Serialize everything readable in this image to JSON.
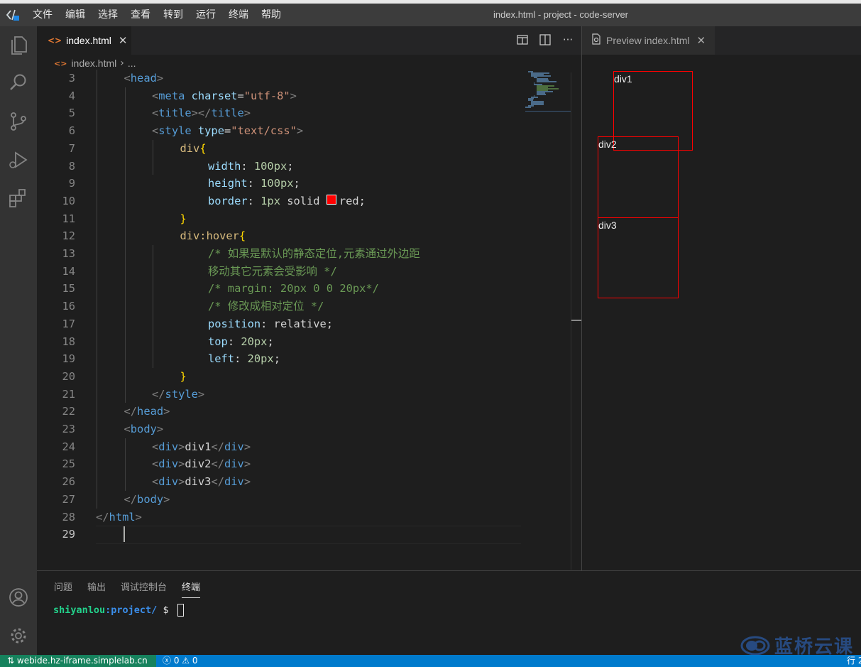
{
  "window": {
    "title": "index.html - project - code-server",
    "menu": [
      "文件",
      "编辑",
      "选择",
      "查看",
      "转到",
      "运行",
      "终端",
      "帮助"
    ]
  },
  "activity_bar": {
    "top_icons": [
      "files-icon",
      "search-icon",
      "source-control-icon",
      "run-debug-icon",
      "extensions-icon"
    ],
    "bottom_icons": [
      "account-icon",
      "settings-gear-icon"
    ]
  },
  "editor": {
    "tab_label": "index.html",
    "breadcrumb": {
      "file": "index.html",
      "trail": "..."
    },
    "current_line": "29",
    "lines": [
      {
        "n": "3",
        "indent": 1,
        "tokens": [
          [
            "t-punc",
            "<"
          ],
          [
            "t-tag",
            "head"
          ],
          [
            "t-punc",
            ">"
          ]
        ]
      },
      {
        "n": "4",
        "indent": 2,
        "tokens": [
          [
            "t-punc",
            "<"
          ],
          [
            "t-tag",
            "meta "
          ],
          [
            "t-attr",
            "charset"
          ],
          [
            "t-txt",
            "="
          ],
          [
            "t-str",
            "\"utf-8\""
          ],
          [
            "t-punc",
            ">"
          ]
        ]
      },
      {
        "n": "5",
        "indent": 2,
        "tokens": [
          [
            "t-punc",
            "<"
          ],
          [
            "t-tag",
            "title"
          ],
          [
            "t-punc",
            "></"
          ],
          [
            "t-tag",
            "title"
          ],
          [
            "t-punc",
            ">"
          ]
        ]
      },
      {
        "n": "6",
        "indent": 2,
        "tokens": [
          [
            "t-punc",
            "<"
          ],
          [
            "t-tag",
            "style "
          ],
          [
            "t-attr",
            "type"
          ],
          [
            "t-txt",
            "="
          ],
          [
            "t-str",
            "\"text/css\""
          ],
          [
            "t-punc",
            ">"
          ]
        ]
      },
      {
        "n": "7",
        "indent": 3,
        "tokens": [
          [
            "t-sel",
            "div"
          ],
          [
            "t-brace",
            "{"
          ]
        ]
      },
      {
        "n": "8",
        "indent": 4,
        "tokens": [
          [
            "t-prop",
            "width"
          ],
          [
            "t-txt",
            ": "
          ],
          [
            "t-num",
            "100px"
          ],
          [
            "t-txt",
            ";"
          ]
        ]
      },
      {
        "n": "9",
        "indent": 4,
        "tokens": [
          [
            "t-prop",
            "height"
          ],
          [
            "t-txt",
            ": "
          ],
          [
            "t-num",
            "100px"
          ],
          [
            "t-txt",
            ";"
          ]
        ]
      },
      {
        "n": "10",
        "indent": 4,
        "tokens": [
          [
            "t-prop",
            "border"
          ],
          [
            "t-txt",
            ": "
          ],
          [
            "t-num",
            "1px"
          ],
          [
            "t-txt",
            " solid "
          ],
          [
            "swatch",
            ""
          ],
          [
            "t-txt",
            "red;"
          ]
        ]
      },
      {
        "n": "11",
        "indent": 3,
        "tokens": [
          [
            "t-brace",
            "}"
          ]
        ]
      },
      {
        "n": "12",
        "indent": 3,
        "tokens": [
          [
            "t-sel",
            "div:hover"
          ],
          [
            "t-brace",
            "{"
          ]
        ]
      },
      {
        "n": "13",
        "indent": 4,
        "tokens": [
          [
            "t-cm",
            "/* 如果是默认的静态定位,元素通过外边距"
          ]
        ]
      },
      {
        "n": "14",
        "indent": 4,
        "tokens": [
          [
            "t-cm",
            "移动其它元素会受影响 */"
          ]
        ]
      },
      {
        "n": "15",
        "indent": 4,
        "tokens": [
          [
            "t-cm",
            "/* margin: 20px 0 0 20px*/"
          ]
        ]
      },
      {
        "n": "16",
        "indent": 4,
        "tokens": [
          [
            "t-cm",
            "/* 修改成相对定位 */"
          ]
        ]
      },
      {
        "n": "17",
        "indent": 4,
        "tokens": [
          [
            "t-prop",
            "position"
          ],
          [
            "t-txt",
            ": relative;"
          ]
        ]
      },
      {
        "n": "18",
        "indent": 4,
        "tokens": [
          [
            "t-prop",
            "top"
          ],
          [
            "t-txt",
            ": "
          ],
          [
            "t-num",
            "20px"
          ],
          [
            "t-txt",
            ";"
          ]
        ]
      },
      {
        "n": "19",
        "indent": 4,
        "tokens": [
          [
            "t-prop",
            "left"
          ],
          [
            "t-txt",
            ": "
          ],
          [
            "t-num",
            "20px"
          ],
          [
            "t-txt",
            ";"
          ]
        ]
      },
      {
        "n": "20",
        "indent": 3,
        "tokens": [
          [
            "t-brace",
            "}"
          ]
        ]
      },
      {
        "n": "21",
        "indent": 2,
        "tokens": [
          [
            "t-punc",
            "</"
          ],
          [
            "t-tag",
            "style"
          ],
          [
            "t-punc",
            ">"
          ]
        ]
      },
      {
        "n": "22",
        "indent": 1,
        "tokens": [
          [
            "t-punc",
            "</"
          ],
          [
            "t-tag",
            "head"
          ],
          [
            "t-punc",
            ">"
          ]
        ]
      },
      {
        "n": "23",
        "indent": 1,
        "tokens": [
          [
            "t-punc",
            "<"
          ],
          [
            "t-tag",
            "body"
          ],
          [
            "t-punc",
            ">"
          ]
        ]
      },
      {
        "n": "24",
        "indent": 2,
        "tokens": [
          [
            "t-punc",
            "<"
          ],
          [
            "t-tag",
            "div"
          ],
          [
            "t-punc",
            ">"
          ],
          [
            "t-txt",
            "div1"
          ],
          [
            "t-punc",
            "</"
          ],
          [
            "t-tag",
            "div"
          ],
          [
            "t-punc",
            ">"
          ]
        ]
      },
      {
        "n": "25",
        "indent": 2,
        "tokens": [
          [
            "t-punc",
            "<"
          ],
          [
            "t-tag",
            "div"
          ],
          [
            "t-punc",
            ">"
          ],
          [
            "t-txt",
            "div2"
          ],
          [
            "t-punc",
            "</"
          ],
          [
            "t-tag",
            "div"
          ],
          [
            "t-punc",
            ">"
          ]
        ]
      },
      {
        "n": "26",
        "indent": 2,
        "tokens": [
          [
            "t-punc",
            "<"
          ],
          [
            "t-tag",
            "div"
          ],
          [
            "t-punc",
            ">"
          ],
          [
            "t-txt",
            "div3"
          ],
          [
            "t-punc",
            "</"
          ],
          [
            "t-tag",
            "div"
          ],
          [
            "t-punc",
            ">"
          ]
        ]
      },
      {
        "n": "27",
        "indent": 1,
        "tokens": [
          [
            "t-punc",
            "</"
          ],
          [
            "t-tag",
            "body"
          ],
          [
            "t-punc",
            ">"
          ]
        ]
      },
      {
        "n": "28",
        "indent": 0,
        "tokens": [
          [
            "t-punc",
            "</"
          ],
          [
            "t-tag",
            "html"
          ],
          [
            "t-punc",
            ">"
          ]
        ]
      },
      {
        "n": "29",
        "indent": 0,
        "tokens": []
      }
    ],
    "colors": {
      "swatch": "#ff0000"
    }
  },
  "preview": {
    "tab_label": "Preview index.html",
    "boxes": [
      "div1",
      "div2",
      "div3"
    ],
    "box_border_color": "#ff0000"
  },
  "panel": {
    "tabs": [
      "问题",
      "输出",
      "调试控制台",
      "终端"
    ],
    "active_tab": "终端",
    "prompt": {
      "user": "shiyanlou",
      "path": ":project/",
      "symbol": " $ "
    }
  },
  "watermark": {
    "text": "蓝桥云课"
  },
  "statusbar": {
    "remote": "webide.hz-iframe.simplelab.cn",
    "errors": "0",
    "warnings": "0",
    "right_text": "行 2"
  }
}
